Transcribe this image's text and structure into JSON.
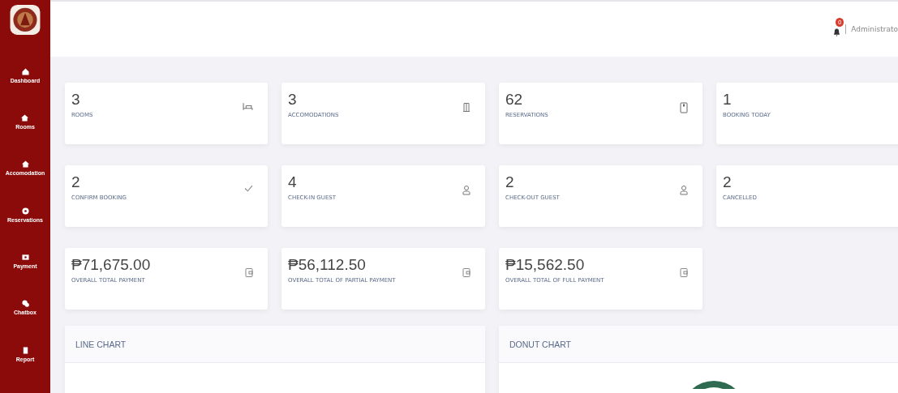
{
  "sidebar": {
    "items": [
      {
        "label": "Dashboard",
        "kind": "home"
      },
      {
        "label": "Rooms",
        "kind": "house"
      },
      {
        "label": "Accomodation",
        "kind": "house"
      },
      {
        "label": "Reservations",
        "kind": "circle"
      },
      {
        "label": "Payment",
        "kind": "card"
      },
      {
        "label": "Chatbox",
        "kind": "chat"
      },
      {
        "label": "Report",
        "kind": "file"
      }
    ]
  },
  "header": {
    "notifications": {
      "count": "0"
    },
    "user": "Administrato"
  },
  "stats": [
    {
      "value": "3",
      "label": "ROOMS",
      "kind": "bed"
    },
    {
      "value": "3",
      "label": "ACCOMODATIONS",
      "kind": "door"
    },
    {
      "value": "62",
      "label": "RESERVATIONS",
      "kind": "phone"
    },
    {
      "value": "1",
      "label": "BOOKING TODAY"
    },
    {
      "value": "2",
      "label": "CONFIRM BOOKING",
      "kind": "check"
    },
    {
      "value": "4",
      "label": "CHECK-IN GUEST",
      "kind": "person"
    },
    {
      "value": "2",
      "label": "CHECK-OUT GUEST",
      "kind": "person"
    },
    {
      "value": "2",
      "label": "CANCELLED"
    },
    {
      "value": "₱71,675.00",
      "label": "OVERALL TOTAL PAYMENT",
      "kind": "wallet"
    },
    {
      "value": "₱56,112.50",
      "label": "OVERALL TOTAL OF PARTIAL PAYMENT",
      "kind": "wallet"
    },
    {
      "value": "₱15,562.50",
      "label": "OVERALL TOTAL OF FULL PAYMENT",
      "kind": "wallet"
    }
  ],
  "panels": [
    {
      "title": "LINE CHART",
      "kind": "line"
    },
    {
      "title": "DONUT CHART",
      "kind": "donut"
    }
  ]
}
